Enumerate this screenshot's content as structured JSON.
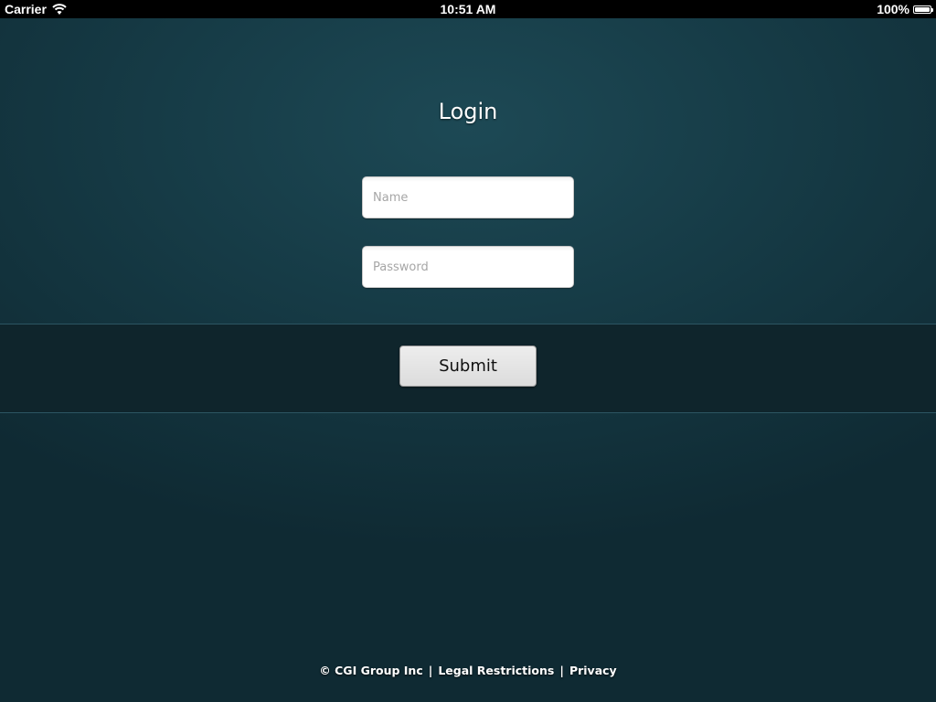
{
  "status_bar": {
    "carrier": "Carrier",
    "time": "10:51 AM",
    "battery": "100%",
    "battery_level": 1.0,
    "icons": [
      "wifi-icon",
      "battery-icon"
    ]
  },
  "login": {
    "title": "Login",
    "name_placeholder": "Name",
    "name_value": "",
    "password_placeholder": "Password",
    "password_value": "",
    "submit_label": "Submit"
  },
  "footer": {
    "copyright": "© CGI Group Inc",
    "separator": "|",
    "legal_link": "Legal Restrictions",
    "privacy_link": "Privacy"
  },
  "colors": {
    "background": "#163b46",
    "band": "#0f252c",
    "text": "#ffffff"
  }
}
